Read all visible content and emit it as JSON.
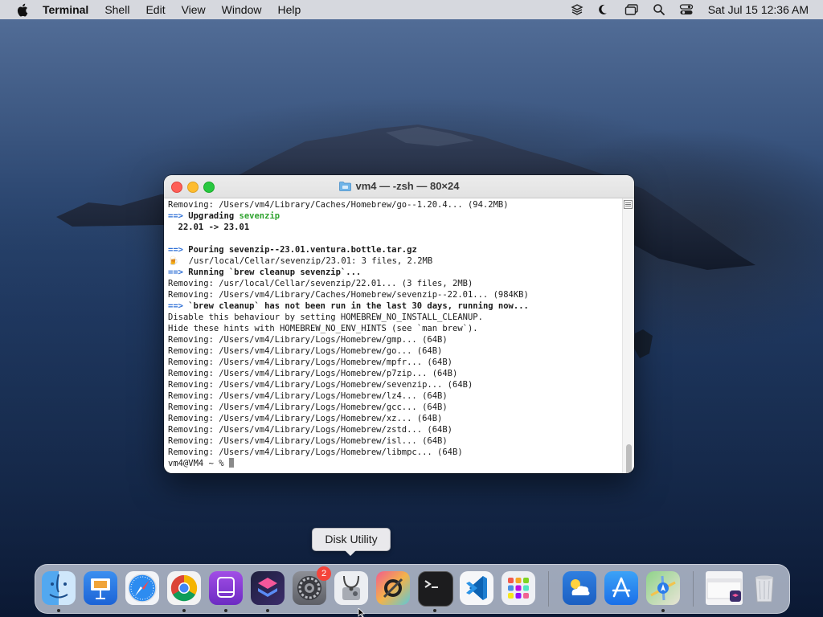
{
  "menubar": {
    "app_name": "Terminal",
    "menus": [
      "Shell",
      "Edit",
      "View",
      "Window",
      "Help"
    ],
    "clock": "Sat Jul 15  12:36 AM",
    "status_icons": [
      "stack-icon",
      "moon-icon",
      "screen-mirroring-icon",
      "search-icon",
      "control-center-icon"
    ]
  },
  "window": {
    "title": "vm4 — -zsh — 80×24",
    "lines": [
      [
        {
          "t": "Removing: /Users/vm4/Library/Caches/Homebrew/go--1.20.4... (94.2MB)"
        }
      ],
      [
        {
          "t": "==>",
          "s": "arrow"
        },
        {
          "t": " Upgrading ",
          "s": "b"
        },
        {
          "t": "sevenzip",
          "s": "g"
        }
      ],
      [
        {
          "t": "  22.01 -> 23.01",
          "s": "b"
        }
      ],
      [
        {
          "t": ""
        }
      ],
      [
        {
          "t": "==>",
          "s": "arrow"
        },
        {
          "t": " Pouring sevenzip--23.01.ventura.bottle.tar.gz",
          "s": "b"
        }
      ],
      [
        {
          "t": "🍺",
          "s": "emoji"
        },
        {
          "t": "  /usr/local/Cellar/sevenzip/23.01: 3 files, 2.2MB"
        }
      ],
      [
        {
          "t": "==>",
          "s": "arrow"
        },
        {
          "t": " Running `brew cleanup sevenzip`...",
          "s": "b"
        }
      ],
      [
        {
          "t": "Removing: /usr/local/Cellar/sevenzip/22.01... (3 files, 2MB)"
        }
      ],
      [
        {
          "t": "Removing: /Users/vm4/Library/Caches/Homebrew/sevenzip--22.01... (984KB)"
        }
      ],
      [
        {
          "t": "==>",
          "s": "arrow"
        },
        {
          "t": " `brew cleanup` has not been run in the last 30 days, running now...",
          "s": "b"
        }
      ],
      [
        {
          "t": "Disable this behaviour by setting HOMEBREW_NO_INSTALL_CLEANUP."
        }
      ],
      [
        {
          "t": "Hide these hints with HOMEBREW_NO_ENV_HINTS (see `man brew`)."
        }
      ],
      [
        {
          "t": "Removing: /Users/vm4/Library/Logs/Homebrew/gmp... (64B)"
        }
      ],
      [
        {
          "t": "Removing: /Users/vm4/Library/Logs/Homebrew/go... (64B)"
        }
      ],
      [
        {
          "t": "Removing: /Users/vm4/Library/Logs/Homebrew/mpfr... (64B)"
        }
      ],
      [
        {
          "t": "Removing: /Users/vm4/Library/Logs/Homebrew/p7zip... (64B)"
        }
      ],
      [
        {
          "t": "Removing: /Users/vm4/Library/Logs/Homebrew/sevenzip... (64B)"
        }
      ],
      [
        {
          "t": "Removing: /Users/vm4/Library/Logs/Homebrew/lz4... (64B)"
        }
      ],
      [
        {
          "t": "Removing: /Users/vm4/Library/Logs/Homebrew/gcc... (64B)"
        }
      ],
      [
        {
          "t": "Removing: /Users/vm4/Library/Logs/Homebrew/xz... (64B)"
        }
      ],
      [
        {
          "t": "Removing: /Users/vm4/Library/Logs/Homebrew/zstd... (64B)"
        }
      ],
      [
        {
          "t": "Removing: /Users/vm4/Library/Logs/Homebrew/isl... (64B)"
        }
      ],
      [
        {
          "t": "Removing: /Users/vm4/Library/Logs/Homebrew/libmpc... (64B)"
        }
      ],
      [
        {
          "t": "vm4@VM4 ~ % "
        },
        {
          "t": "",
          "s": "cursor"
        }
      ]
    ]
  },
  "tooltip": "Disk Utility",
  "dock": {
    "badge_count": "2",
    "apps": [
      {
        "name": "finder",
        "running": true
      },
      {
        "name": "keynote",
        "running": false
      },
      {
        "name": "safari",
        "running": false
      },
      {
        "name": "chrome",
        "running": true
      },
      {
        "name": "podcasts",
        "running": true
      },
      {
        "name": "shortcuts",
        "running": true
      },
      {
        "name": "system-settings",
        "running": false
      },
      {
        "name": "disk-utility",
        "running": false
      },
      {
        "name": "system-toolkit",
        "running": false
      },
      {
        "name": "terminal",
        "running": true
      },
      {
        "name": "vscode",
        "running": false
      },
      {
        "name": "launchpad",
        "running": false
      },
      {
        "name": "weather",
        "running": false
      },
      {
        "name": "app-store",
        "running": false
      },
      {
        "name": "maps",
        "running": true
      },
      {
        "name": "recent-window",
        "running": false
      },
      {
        "name": "trash",
        "running": false
      }
    ]
  }
}
